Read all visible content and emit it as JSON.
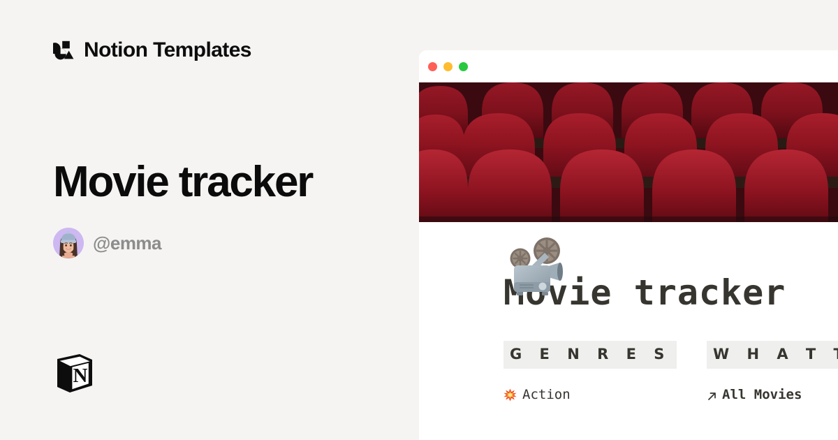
{
  "brand": {
    "name": "Notion Templates",
    "logo_icon": "notion-templates-mark"
  },
  "hero": {
    "title": "Movie tracker",
    "author_handle": "@emma",
    "avatar_icon": "user-avatar-memoji",
    "footer_logo_icon": "notion-cube-logo"
  },
  "window": {
    "traffic_lights": [
      {
        "name": "close",
        "color": "#ff5f57"
      },
      {
        "name": "minimize",
        "color": "#febc2e"
      },
      {
        "name": "maximize",
        "color": "#28c840"
      }
    ],
    "cover_image_alt": "red cinema theater seats",
    "page_icon": "film-projector-emoji"
  },
  "document": {
    "title": "Movie tracker",
    "columns": [
      {
        "heading": "G E N R E S",
        "items": [
          {
            "emoji": "collision-emoji",
            "label": "Action"
          }
        ]
      },
      {
        "heading": "W H A T   T",
        "items": [
          {
            "emoji": "arrow-up-right-icon",
            "label": "All Movies"
          }
        ]
      }
    ]
  },
  "colors": {
    "page_background": "#f5f4f2",
    "window_background": "#ffffff",
    "text_primary": "#0b0b0b",
    "text_muted": "#8c8c8c",
    "notion_text": "#37352f",
    "heading_block": "#efefed",
    "cover_red": "#8e1420"
  }
}
